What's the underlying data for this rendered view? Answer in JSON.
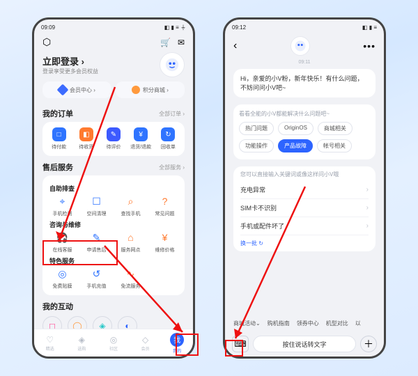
{
  "left": {
    "status_time": "09:09",
    "login": {
      "title": "立即登录 ›",
      "subtitle": "登录享受更多会员权益"
    },
    "banners": [
      {
        "icon": "blue",
        "label": "会员中心 ›"
      },
      {
        "icon": "orange",
        "label": "积分商城 ›"
      }
    ],
    "orders": {
      "title": "我的订单",
      "more": "全部订单 ›",
      "items": [
        {
          "icon": "□",
          "label": "待付款",
          "color": "#2f74ff"
        },
        {
          "icon": "◧",
          "label": "待收货",
          "color": "#ff7a2f"
        },
        {
          "icon": "✎",
          "label": "待评价",
          "color": "#3c5aff"
        },
        {
          "icon": "¥",
          "label": "退货/退款",
          "color": "#2f74ff"
        },
        {
          "icon": "↻",
          "label": "回收单",
          "color": "#2f74ff"
        }
      ]
    },
    "service": {
      "title": "售后服务",
      "more": "全部服务 ›",
      "groups": [
        {
          "label": "自助排查",
          "items": [
            {
              "icon": "⌖",
              "label": "手机检测"
            },
            {
              "icon": "☐",
              "label": "空间清理"
            },
            {
              "icon": "⌕",
              "label": "查找手机",
              "or": true
            },
            {
              "icon": "?",
              "label": "常见问题",
              "or": true
            }
          ]
        },
        {
          "label": "咨询与维修",
          "items": [
            {
              "icon": "🎧",
              "label": "在线客服"
            },
            {
              "icon": "✎",
              "label": "申请售后"
            },
            {
              "icon": "⌂",
              "label": "服务网点",
              "or": true
            },
            {
              "icon": "¥",
              "label": "维修价格",
              "or": true
            }
          ]
        },
        {
          "label": "特色服务",
          "items": [
            {
              "icon": "◎",
              "label": "免费贴膜"
            },
            {
              "icon": "↺",
              "label": "手机充值"
            },
            {
              "icon": "∿",
              "label": "免流服务",
              "or": true
            }
          ]
        }
      ]
    },
    "interact": {
      "title": "我的互动"
    },
    "tabs": [
      {
        "icon": "♡",
        "label": "精选"
      },
      {
        "icon": "◈",
        "label": "选购"
      },
      {
        "icon": "◎",
        "label": "社区"
      },
      {
        "icon": "◇",
        "label": "会员"
      },
      {
        "icon": "我",
        "label": "我的",
        "active": true
      }
    ]
  },
  "right": {
    "status_time": "09:12",
    "chat_time": "09:11",
    "greeting": "Hi，亲爱的小V粉，新年快乐！有什么问题，不妨问问小V吧~",
    "cat_header": "看看全能的小V都能解决什么问题吧~",
    "chips": [
      {
        "label": "热门问题"
      },
      {
        "label": "OriginOS"
      },
      {
        "label": "商城相关"
      },
      {
        "label": "功能操作"
      },
      {
        "label": "产品故障",
        "active": true
      },
      {
        "label": "帐号相关"
      }
    ],
    "list_header": "您可以直接输入关键词或像这样问小V哦",
    "list": [
      "充电异常",
      "SIM卡不识别",
      "手机或配件坏了"
    ],
    "refresh": "换一批 ↻",
    "suggestions": [
      "商城活动⌄",
      "购机指南",
      "领券中心",
      "机型对比",
      "以"
    ],
    "voice_placeholder": "按住说话转文字"
  }
}
